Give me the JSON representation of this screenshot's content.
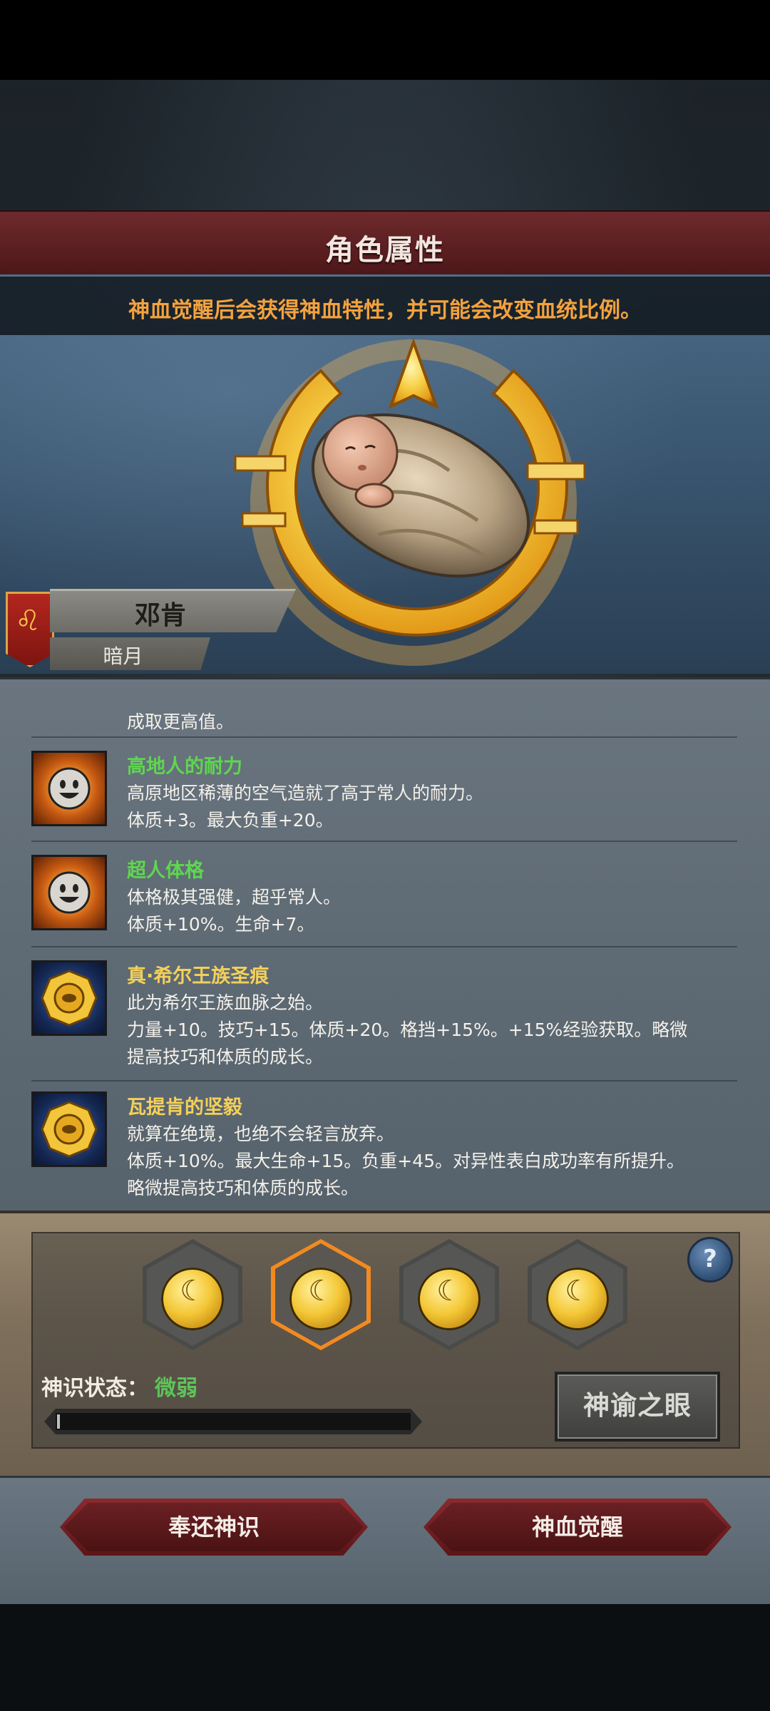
{
  "header": {
    "title": "角色属性"
  },
  "notice": "神血觉醒后会获得神血特性，并可能会改变血统比例。",
  "character": {
    "name": "邓肯",
    "title": "暗月"
  },
  "traits": {
    "partial_line": "成取更高值。",
    "items": [
      {
        "name": "高地人的耐力",
        "name_color": "#5fd64f",
        "icon": "smiley-sun-icon",
        "lines": [
          "高原地区稀薄的空气造就了高于常人的耐力。",
          "体质+3。最大负重+20。"
        ]
      },
      {
        "name": "超人体格",
        "name_color": "#5fd64f",
        "icon": "smiley-sun-icon",
        "lines": [
          "体格极其强健，超乎常人。",
          "体质+10%。生命+7。"
        ]
      },
      {
        "name": "真·希尔王族圣痕",
        "name_color": "#f3d05a",
        "icon": "royal-seal-icon",
        "lines": [
          "此为希尔王族血脉之始。",
          "力量+10。技巧+15。体质+20。格挡+15%。+15%经验获取。略微",
          "提高技巧和体质的成长。"
        ]
      },
      {
        "name": "瓦提肯的坚毅",
        "name_color": "#f3d05a",
        "icon": "royal-seal-icon",
        "lines": [
          "就算在绝境，也绝不会轻言放弃。",
          "体质+10%。最大生命+15。负重+45。对异性表白成功率有所提升。",
          "略微提高技巧和体质的成长。"
        ]
      }
    ]
  },
  "awakening": {
    "slots": [
      {
        "icon": "moon-sigil-icon",
        "selected": false
      },
      {
        "icon": "moon-sigil-icon",
        "selected": true
      },
      {
        "icon": "moon-sigil-icon",
        "selected": false
      },
      {
        "icon": "moon-sigil-icon",
        "selected": false
      }
    ],
    "help_label": "?",
    "state_label": "神识状态：",
    "state_value": "微弱",
    "progress_fraction": 0.005,
    "oracle_label": "神谕之眼"
  },
  "actions": {
    "return_label": "奉还神识",
    "awaken_label": "神血觉醒"
  },
  "colors": {
    "accent": "#f3a23e",
    "banner": "#5a1e20",
    "state_ok": "#5dc45a",
    "select": "#f28a1f"
  }
}
